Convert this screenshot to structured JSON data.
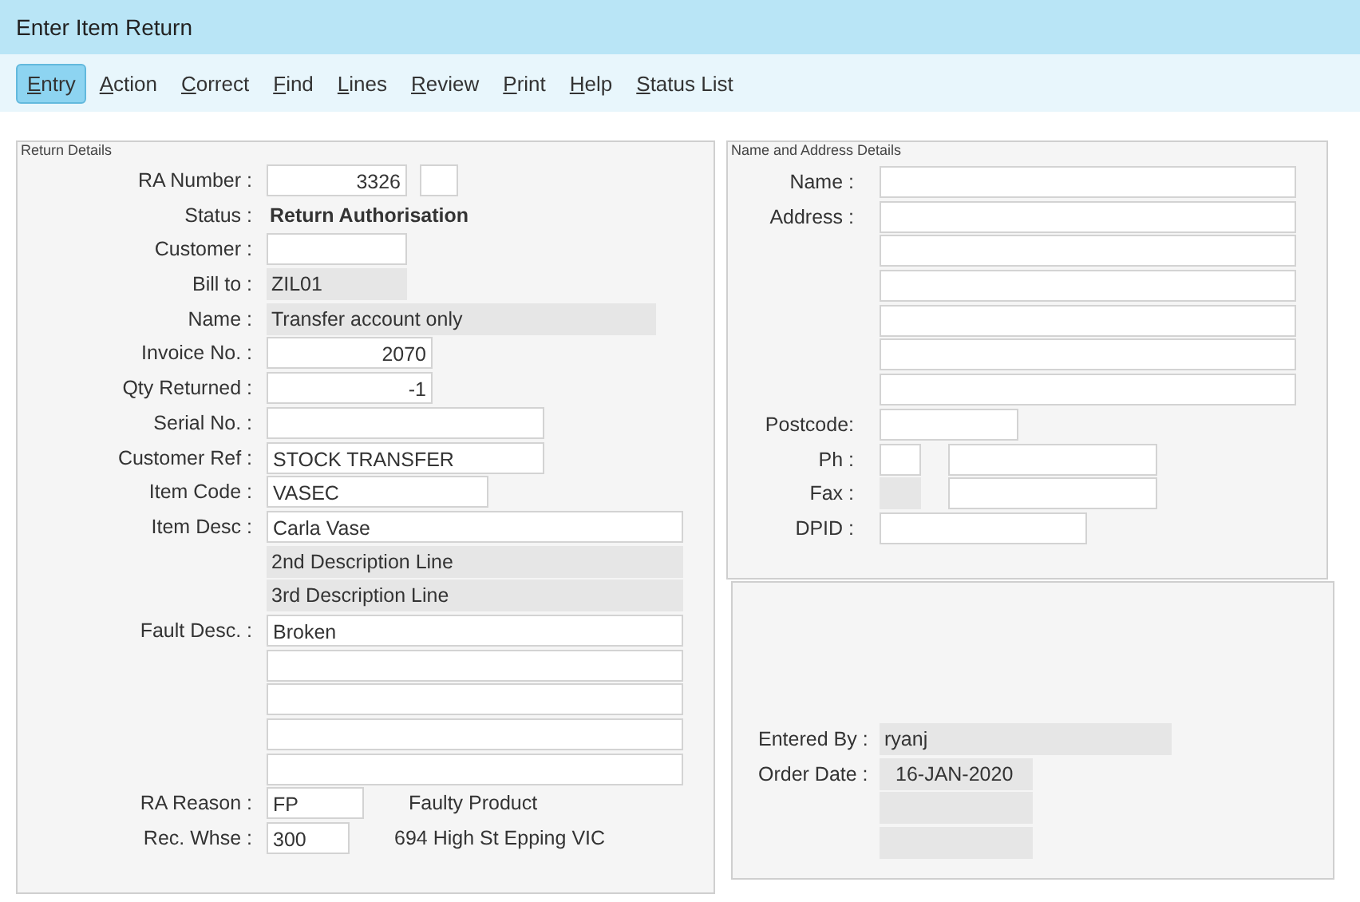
{
  "window": {
    "title": "Enter Item Return"
  },
  "menu": [
    {
      "label": "Entry",
      "selected": true
    },
    {
      "label": "Action",
      "selected": false
    },
    {
      "label": "Correct",
      "selected": false
    },
    {
      "label": "Find",
      "selected": false
    },
    {
      "label": "Lines",
      "selected": false
    },
    {
      "label": "Review",
      "selected": false
    },
    {
      "label": "Print",
      "selected": false
    },
    {
      "label": "Help",
      "selected": false
    },
    {
      "label": "Status List",
      "selected": false
    }
  ],
  "return_details": {
    "title": "Return Details",
    "rows": [
      {
        "label": "RA Number :",
        "fields": [
          {
            "kind": "number",
            "value": "3326"
          },
          {
            "kind": "input"
          }
        ]
      },
      {
        "label": "Status :",
        "fields": [
          {
            "kind": "bold",
            "value": "Return Authorisation"
          }
        ]
      },
      {
        "label": "Customer :",
        "fields": [
          {
            "kind": "input"
          }
        ]
      },
      {
        "label": "Bill to :",
        "fields": [
          {
            "kind": "readonly",
            "value": "ZIL01"
          }
        ]
      },
      {
        "label": "Name :",
        "fields": [
          {
            "kind": "readonly",
            "value": "Transfer account only"
          }
        ]
      },
      {
        "label": "Invoice No. :",
        "fields": [
          {
            "kind": "number",
            "value": "2070"
          }
        ]
      },
      {
        "label": "Qty Returned :",
        "fields": [
          {
            "kind": "number",
            "value": "-1"
          }
        ]
      },
      {
        "label": "Serial No. :",
        "fields": [
          {
            "kind": "input"
          }
        ]
      },
      {
        "label": "Customer Ref :",
        "fields": [
          {
            "kind": "input",
            "value": "STOCK TRANSFER"
          }
        ]
      },
      {
        "label": "Item Code :",
        "fields": [
          {
            "kind": "input",
            "value": "VASEC"
          }
        ]
      },
      {
        "label": "Item Desc :",
        "fields": [
          {
            "kind": "input",
            "value": "Carla Vase"
          }
        ]
      },
      {
        "fields": [
          {
            "kind": "readonly",
            "value": "2nd Description Line"
          }
        ]
      },
      {
        "fields": [
          {
            "kind": "readonly",
            "value": "3rd Description Line"
          }
        ]
      },
      {
        "label": "Fault Desc. :",
        "fields": [
          {
            "kind": "input",
            "value": "Broken"
          }
        ]
      },
      {
        "fields": [
          {
            "kind": "input"
          }
        ]
      },
      {
        "fields": [
          {
            "kind": "input"
          }
        ]
      },
      {
        "fields": [
          {
            "kind": "input"
          }
        ]
      },
      {
        "fields": [
          {
            "kind": "input"
          }
        ]
      },
      {
        "label": "RA Reason :",
        "fields": [
          {
            "kind": "input",
            "value": "FP"
          },
          {
            "kind": "text",
            "value": "Faulty Product"
          }
        ]
      },
      {
        "label": "Rec. Whse :",
        "fields": [
          {
            "kind": "input",
            "value": "300"
          },
          {
            "kind": "text",
            "value": "694 High St Epping VIC"
          }
        ]
      }
    ]
  },
  "name_address": {
    "title": "Name and Address Details",
    "rows": [
      {
        "label": "Name :",
        "fields": [
          {
            "kind": "input"
          }
        ]
      },
      {
        "label": "Address :",
        "fields": [
          {
            "kind": "input"
          }
        ]
      },
      {
        "fields": [
          {
            "kind": "input"
          }
        ]
      },
      {
        "fields": [
          {
            "kind": "input"
          }
        ]
      },
      {
        "fields": [
          {
            "kind": "input"
          }
        ]
      },
      {
        "fields": [
          {
            "kind": "input"
          }
        ]
      },
      {
        "fields": [
          {
            "kind": "input"
          }
        ]
      },
      {
        "label": "Postcode:",
        "fields": [
          {
            "kind": "input"
          }
        ]
      },
      {
        "label": "Ph :",
        "fields": [
          {
            "kind": "input"
          },
          {
            "kind": "input"
          }
        ]
      },
      {
        "label": "Fax :",
        "fields": [
          {
            "kind": "readonly"
          },
          {
            "kind": "input"
          }
        ]
      },
      {
        "label": "DPID :",
        "fields": [
          {
            "kind": "input"
          }
        ]
      }
    ]
  },
  "entry_info": {
    "rows": [
      {
        "label": "Entered By :",
        "fields": [
          {
            "kind": "readonly",
            "value": "ryanj"
          }
        ]
      },
      {
        "label": "Order Date :",
        "fields": [
          {
            "kind": "readonly",
            "value": "16-JAN-2020"
          }
        ]
      },
      {
        "fields": [
          {
            "kind": "readonly"
          }
        ]
      },
      {
        "fields": [
          {
            "kind": "readonly"
          }
        ]
      }
    ]
  }
}
